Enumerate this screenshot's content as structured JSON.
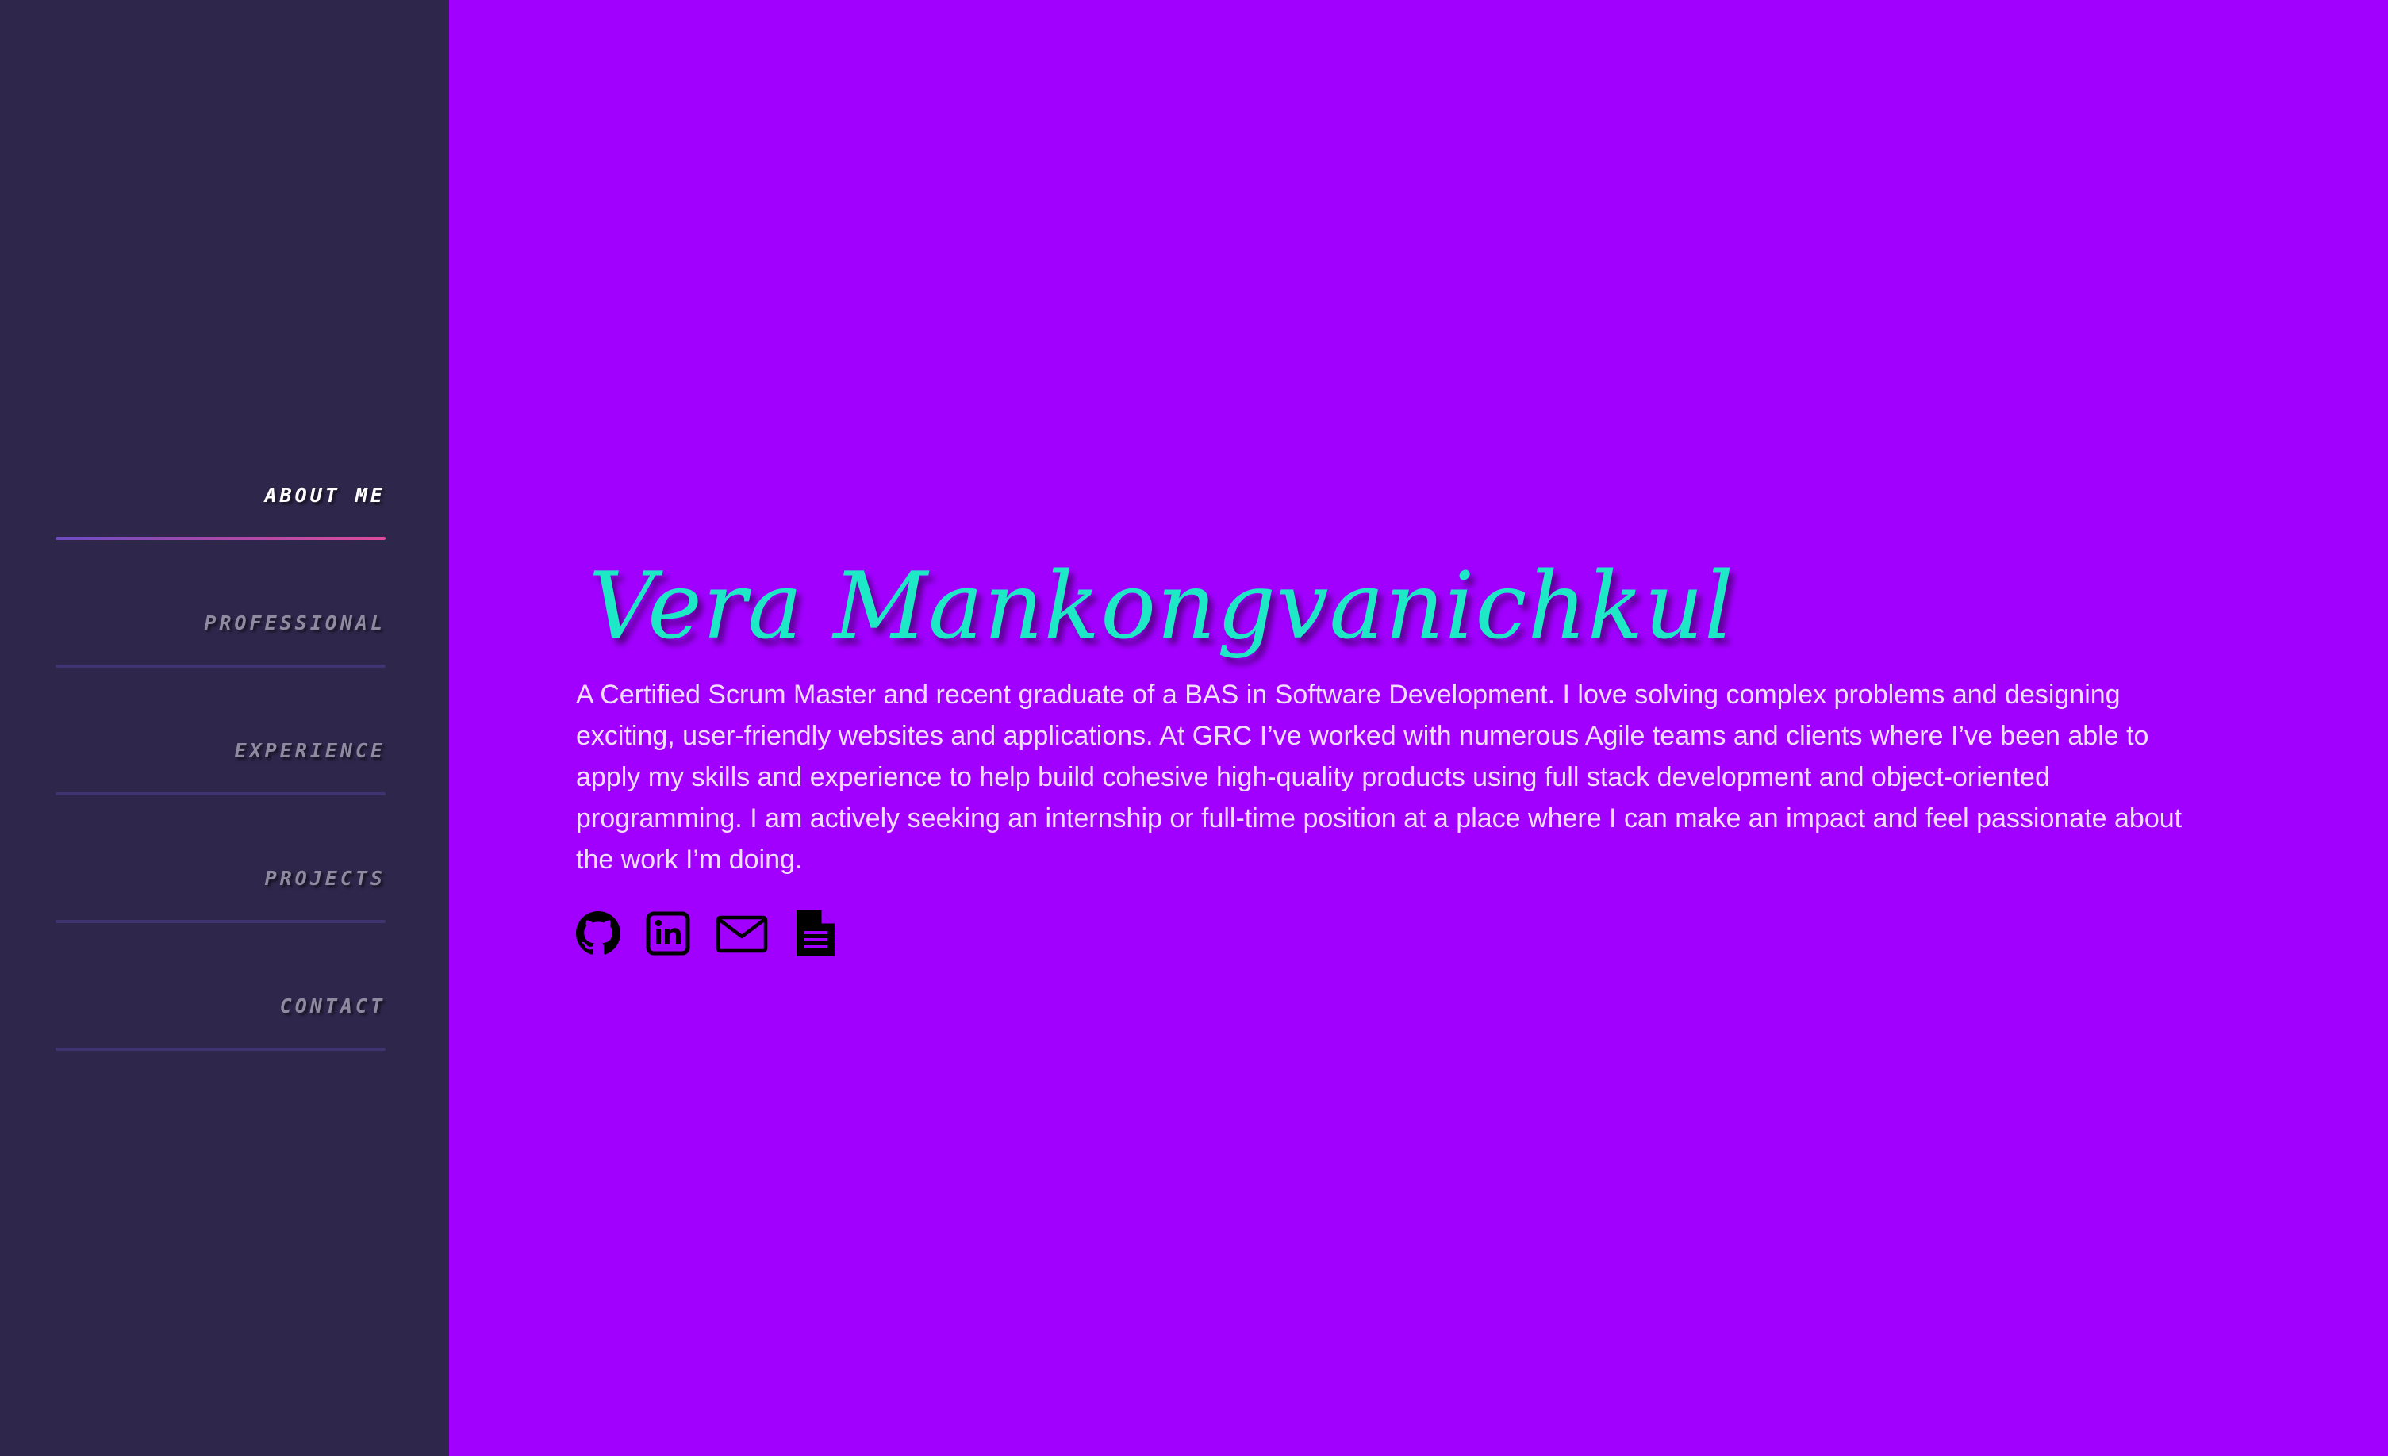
{
  "sidebar": {
    "items": [
      {
        "label": "About Me",
        "active": true
      },
      {
        "label": "Professional",
        "active": false
      },
      {
        "label": "Experience",
        "active": false
      },
      {
        "label": "Projects",
        "active": false
      },
      {
        "label": "Contact",
        "active": false
      }
    ]
  },
  "hero": {
    "name": "Vera Mankongvanichkul",
    "bio": "A Certified Scrum Master and recent graduate of a BAS in Software Development. I love solving complex problems and designing exciting, user-friendly websites and applications. At GRC I’ve worked with numerous Agile teams and clients where I’ve been able to apply my skills and experience to help build cohesive high-quality products using full stack development and object-oriented programming. I am actively seeking an internship or full-time position at a place where I can make an impact and feel passionate about the work I’m doing."
  },
  "social_icons": [
    "github-icon",
    "linkedin-icon",
    "email-icon",
    "resume-document-icon"
  ],
  "colors": {
    "background": "#a100ff",
    "sidebar": "#2f274b",
    "name": "#1de9c6",
    "bio_text": "#f2dcff",
    "nav_inactive": "#8e8aa0",
    "nav_active": "#ffffff",
    "underline": "#3f3370",
    "underline_active_start": "#6c4bbf",
    "underline_active_end": "#e04a9a"
  }
}
